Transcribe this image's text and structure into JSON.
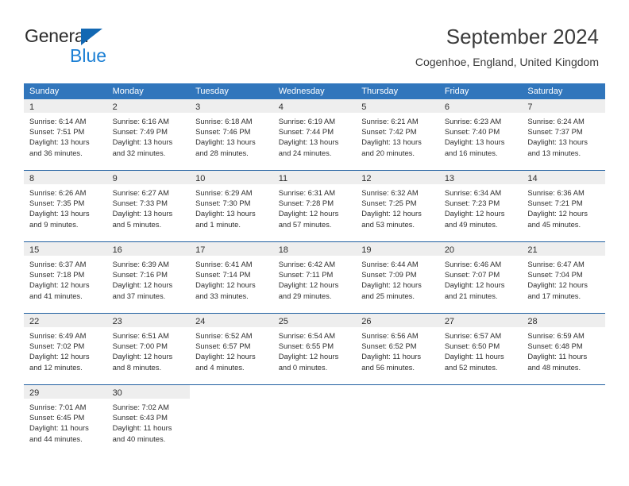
{
  "brand": {
    "line1": "General",
    "line2": "Blue",
    "triangle_color": "#1268b3",
    "blue_text_color": "#1b7fd4"
  },
  "header": {
    "title": "September 2024",
    "subtitle": "Cogenhoe, England, United Kingdom"
  },
  "theme": {
    "header_row_bg": "#3176bc",
    "header_row_text": "#ffffff",
    "daynum_band_bg": "#eeeeee",
    "cell_bg": "#ffffff",
    "grid_line": "#1f5fa0",
    "body_text": "#2f2f2f"
  },
  "weekdays": [
    "Sunday",
    "Monday",
    "Tuesday",
    "Wednesday",
    "Thursday",
    "Friday",
    "Saturday"
  ],
  "weeks": [
    [
      {
        "day": "1",
        "sunrise": "Sunrise: 6:14 AM",
        "sunset": "Sunset: 7:51 PM",
        "daylight": "Daylight: 13 hours and 36 minutes."
      },
      {
        "day": "2",
        "sunrise": "Sunrise: 6:16 AM",
        "sunset": "Sunset: 7:49 PM",
        "daylight": "Daylight: 13 hours and 32 minutes."
      },
      {
        "day": "3",
        "sunrise": "Sunrise: 6:18 AM",
        "sunset": "Sunset: 7:46 PM",
        "daylight": "Daylight: 13 hours and 28 minutes."
      },
      {
        "day": "4",
        "sunrise": "Sunrise: 6:19 AM",
        "sunset": "Sunset: 7:44 PM",
        "daylight": "Daylight: 13 hours and 24 minutes."
      },
      {
        "day": "5",
        "sunrise": "Sunrise: 6:21 AM",
        "sunset": "Sunset: 7:42 PM",
        "daylight": "Daylight: 13 hours and 20 minutes."
      },
      {
        "day": "6",
        "sunrise": "Sunrise: 6:23 AM",
        "sunset": "Sunset: 7:40 PM",
        "daylight": "Daylight: 13 hours and 16 minutes."
      },
      {
        "day": "7",
        "sunrise": "Sunrise: 6:24 AM",
        "sunset": "Sunset: 7:37 PM",
        "daylight": "Daylight: 13 hours and 13 minutes."
      }
    ],
    [
      {
        "day": "8",
        "sunrise": "Sunrise: 6:26 AM",
        "sunset": "Sunset: 7:35 PM",
        "daylight": "Daylight: 13 hours and 9 minutes."
      },
      {
        "day": "9",
        "sunrise": "Sunrise: 6:27 AM",
        "sunset": "Sunset: 7:33 PM",
        "daylight": "Daylight: 13 hours and 5 minutes."
      },
      {
        "day": "10",
        "sunrise": "Sunrise: 6:29 AM",
        "sunset": "Sunset: 7:30 PM",
        "daylight": "Daylight: 13 hours and 1 minute."
      },
      {
        "day": "11",
        "sunrise": "Sunrise: 6:31 AM",
        "sunset": "Sunset: 7:28 PM",
        "daylight": "Daylight: 12 hours and 57 minutes."
      },
      {
        "day": "12",
        "sunrise": "Sunrise: 6:32 AM",
        "sunset": "Sunset: 7:25 PM",
        "daylight": "Daylight: 12 hours and 53 minutes."
      },
      {
        "day": "13",
        "sunrise": "Sunrise: 6:34 AM",
        "sunset": "Sunset: 7:23 PM",
        "daylight": "Daylight: 12 hours and 49 minutes."
      },
      {
        "day": "14",
        "sunrise": "Sunrise: 6:36 AM",
        "sunset": "Sunset: 7:21 PM",
        "daylight": "Daylight: 12 hours and 45 minutes."
      }
    ],
    [
      {
        "day": "15",
        "sunrise": "Sunrise: 6:37 AM",
        "sunset": "Sunset: 7:18 PM",
        "daylight": "Daylight: 12 hours and 41 minutes."
      },
      {
        "day": "16",
        "sunrise": "Sunrise: 6:39 AM",
        "sunset": "Sunset: 7:16 PM",
        "daylight": "Daylight: 12 hours and 37 minutes."
      },
      {
        "day": "17",
        "sunrise": "Sunrise: 6:41 AM",
        "sunset": "Sunset: 7:14 PM",
        "daylight": "Daylight: 12 hours and 33 minutes."
      },
      {
        "day": "18",
        "sunrise": "Sunrise: 6:42 AM",
        "sunset": "Sunset: 7:11 PM",
        "daylight": "Daylight: 12 hours and 29 minutes."
      },
      {
        "day": "19",
        "sunrise": "Sunrise: 6:44 AM",
        "sunset": "Sunset: 7:09 PM",
        "daylight": "Daylight: 12 hours and 25 minutes."
      },
      {
        "day": "20",
        "sunrise": "Sunrise: 6:46 AM",
        "sunset": "Sunset: 7:07 PM",
        "daylight": "Daylight: 12 hours and 21 minutes."
      },
      {
        "day": "21",
        "sunrise": "Sunrise: 6:47 AM",
        "sunset": "Sunset: 7:04 PM",
        "daylight": "Daylight: 12 hours and 17 minutes."
      }
    ],
    [
      {
        "day": "22",
        "sunrise": "Sunrise: 6:49 AM",
        "sunset": "Sunset: 7:02 PM",
        "daylight": "Daylight: 12 hours and 12 minutes."
      },
      {
        "day": "23",
        "sunrise": "Sunrise: 6:51 AM",
        "sunset": "Sunset: 7:00 PM",
        "daylight": "Daylight: 12 hours and 8 minutes."
      },
      {
        "day": "24",
        "sunrise": "Sunrise: 6:52 AM",
        "sunset": "Sunset: 6:57 PM",
        "daylight": "Daylight: 12 hours and 4 minutes."
      },
      {
        "day": "25",
        "sunrise": "Sunrise: 6:54 AM",
        "sunset": "Sunset: 6:55 PM",
        "daylight": "Daylight: 12 hours and 0 minutes."
      },
      {
        "day": "26",
        "sunrise": "Sunrise: 6:56 AM",
        "sunset": "Sunset: 6:52 PM",
        "daylight": "Daylight: 11 hours and 56 minutes."
      },
      {
        "day": "27",
        "sunrise": "Sunrise: 6:57 AM",
        "sunset": "Sunset: 6:50 PM",
        "daylight": "Daylight: 11 hours and 52 minutes."
      },
      {
        "day": "28",
        "sunrise": "Sunrise: 6:59 AM",
        "sunset": "Sunset: 6:48 PM",
        "daylight": "Daylight: 11 hours and 48 minutes."
      }
    ],
    [
      {
        "day": "29",
        "sunrise": "Sunrise: 7:01 AM",
        "sunset": "Sunset: 6:45 PM",
        "daylight": "Daylight: 11 hours and 44 minutes."
      },
      {
        "day": "30",
        "sunrise": "Sunrise: 7:02 AM",
        "sunset": "Sunset: 6:43 PM",
        "daylight": "Daylight: 11 hours and 40 minutes."
      },
      {
        "day": "",
        "sunrise": "",
        "sunset": "",
        "daylight": ""
      },
      {
        "day": "",
        "sunrise": "",
        "sunset": "",
        "daylight": ""
      },
      {
        "day": "",
        "sunrise": "",
        "sunset": "",
        "daylight": ""
      },
      {
        "day": "",
        "sunrise": "",
        "sunset": "",
        "daylight": ""
      },
      {
        "day": "",
        "sunrise": "",
        "sunset": "",
        "daylight": ""
      }
    ]
  ]
}
